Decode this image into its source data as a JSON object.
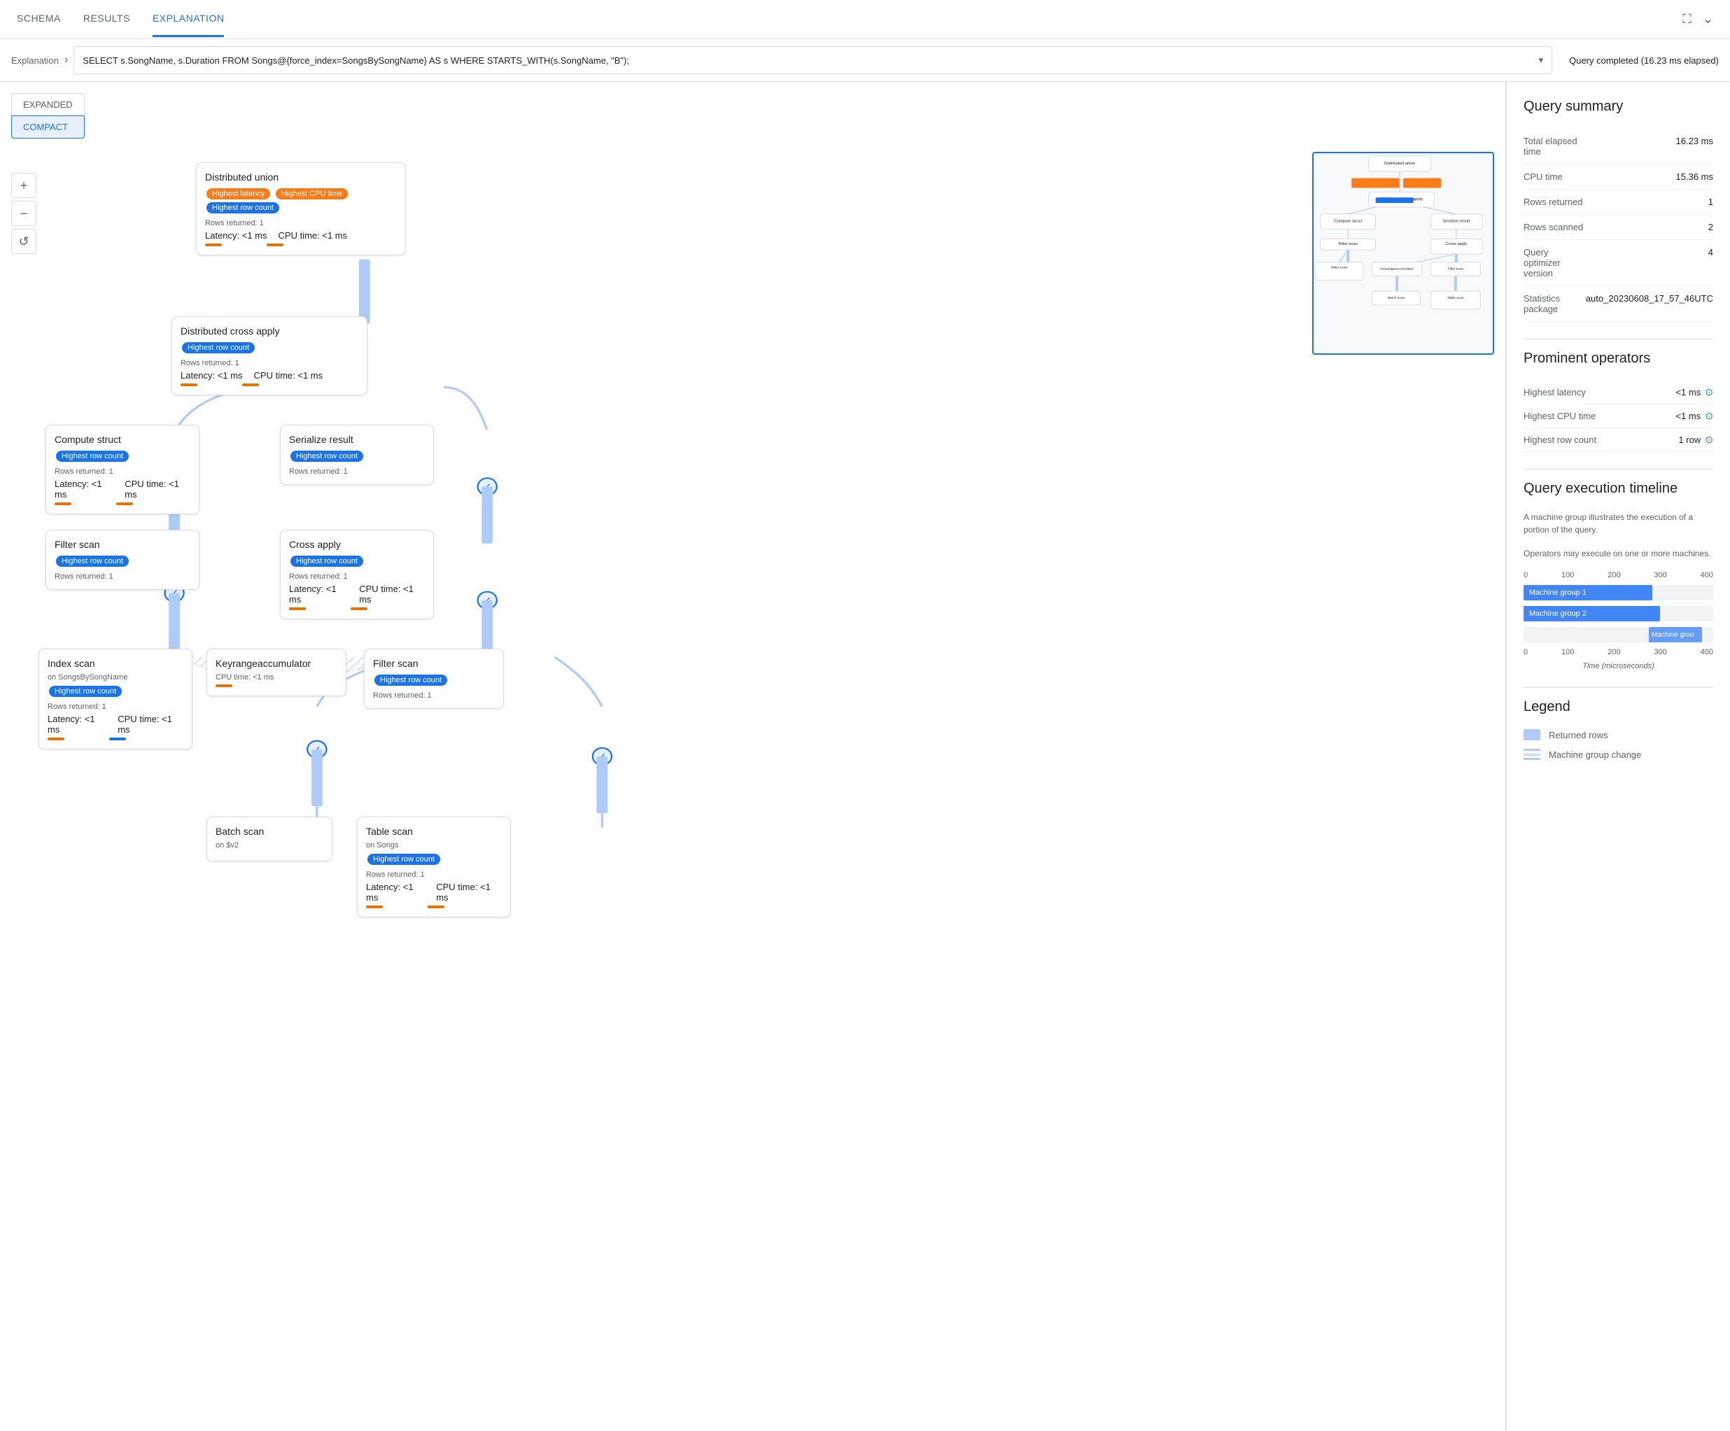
{
  "tabs": {
    "items": [
      "SCHEMA",
      "RESULTS",
      "EXPLANATION"
    ],
    "active": "EXPLANATION"
  },
  "breadcrumb": {
    "link": "Explanation",
    "query": "SELECT s.SongName, s.Duration FROM Songs@{force_index=SongsBySongName} AS s WHERE STARTS_WITH(s.SongName, \"B\");",
    "status": "Query completed (16.23 ms elapsed)"
  },
  "view_toggle": {
    "expanded": "EXPANDED",
    "compact": "COMPACT",
    "active": "COMPACT"
  },
  "zoom": {
    "plus": "+",
    "minus": "−",
    "reset": "↺"
  },
  "nodes": {
    "distributed_union": {
      "title": "Distributed union",
      "badges": [
        "Highest latency",
        "Highest CPU time",
        "Highest row count"
      ],
      "badge_types": [
        "orange",
        "orange",
        "blue"
      ],
      "rows": "Rows returned: 1",
      "latency": "Latency: <1 ms",
      "cpu": "CPU time: <1 ms"
    },
    "distributed_cross_apply": {
      "title": "Distributed cross apply",
      "badges": [
        "Highest row count"
      ],
      "badge_types": [
        "blue"
      ],
      "rows": "Rows returned: 1",
      "latency": "Latency: <1 ms",
      "cpu": "CPU time: <1 ms"
    },
    "compute_struct": {
      "title": "Compute struct",
      "badges": [
        "Highest row count"
      ],
      "badge_types": [
        "blue"
      ],
      "rows": "Rows returned: 1",
      "latency": "Latency: <1 ms",
      "cpu": "CPU time: <1 ms"
    },
    "serialize_result": {
      "title": "Serialize result",
      "badges": [
        "Highest row count"
      ],
      "badge_types": [
        "blue"
      ],
      "rows": "Rows returned: 1"
    },
    "filter_scan_1": {
      "title": "Filter scan",
      "badges": [
        "Highest row count"
      ],
      "badge_types": [
        "blue"
      ],
      "rows": "Rows returned: 1"
    },
    "cross_apply": {
      "title": "Cross apply",
      "badges": [
        "Highest row count"
      ],
      "badge_types": [
        "blue"
      ],
      "rows": "Rows returned: 1",
      "latency": "Latency: <1 ms",
      "cpu": "CPU time: <1 ms"
    },
    "index_scan": {
      "title": "Index scan",
      "subtitle": "on SongsBySongName",
      "badges": [
        "Highest row count"
      ],
      "badge_types": [
        "blue"
      ],
      "rows": "Rows returned: 1",
      "latency": "Latency: <1 ms",
      "cpu": "CPU time: <1 ms"
    },
    "keyrangeaccumulator": {
      "title": "Keyrangeaccumulator",
      "cpu": "CPU time: <1 ms"
    },
    "filter_scan_2": {
      "title": "Filter scan",
      "badges": [
        "Highest row count"
      ],
      "badge_types": [
        "blue"
      ],
      "rows": "Rows returned: 1"
    },
    "batch_scan": {
      "title": "Batch scan",
      "subtitle": "on $v2"
    },
    "table_scan": {
      "title": "Table scan",
      "subtitle": "on Songs",
      "badges": [
        "Highest row count"
      ],
      "badge_types": [
        "blue"
      ],
      "rows": "Rows returned: 1",
      "latency": "Latency: <1 ms",
      "cpu": "CPU time: <1 ms"
    }
  },
  "query_summary": {
    "title": "Query summary",
    "rows": [
      {
        "label": "Total elapsed time",
        "value": "16.23 ms"
      },
      {
        "label": "CPU time",
        "value": "15.36 ms"
      },
      {
        "label": "Rows returned",
        "value": "1"
      },
      {
        "label": "Rows scanned",
        "value": "2"
      },
      {
        "label": "Query optimizer version",
        "value": "4"
      },
      {
        "label": "Statistics package",
        "value": "auto_20230608_17_57_46UTC"
      }
    ]
  },
  "prominent_operators": {
    "title": "Prominent operators",
    "rows": [
      {
        "label": "Highest latency",
        "value": "<1 ms"
      },
      {
        "label": "Highest CPU time",
        "value": "<1 ms"
      },
      {
        "label": "Highest row count",
        "value": "1 row"
      }
    ]
  },
  "execution_timeline": {
    "title": "Query execution timeline",
    "desc1": "A machine group illustrates the execution of a portion of the query.",
    "desc2": "Operators may execute on one or more machines.",
    "axis_labels": [
      "0",
      "100",
      "200",
      "300",
      "400"
    ],
    "bars": [
      {
        "label": "Machine group 1",
        "width_pct": 68,
        "offset_pct": 0
      },
      {
        "label": "Machine group 2",
        "width_pct": 72,
        "offset_pct": 0
      },
      {
        "label": "Machine grou",
        "width_pct": 28,
        "offset_pct": 66
      }
    ],
    "x_label": "Time (microseconds)"
  },
  "legend": {
    "title": "Legend",
    "items": [
      {
        "type": "rows",
        "label": "Returned rows"
      },
      {
        "type": "machine",
        "label": "Machine group change"
      }
    ]
  }
}
